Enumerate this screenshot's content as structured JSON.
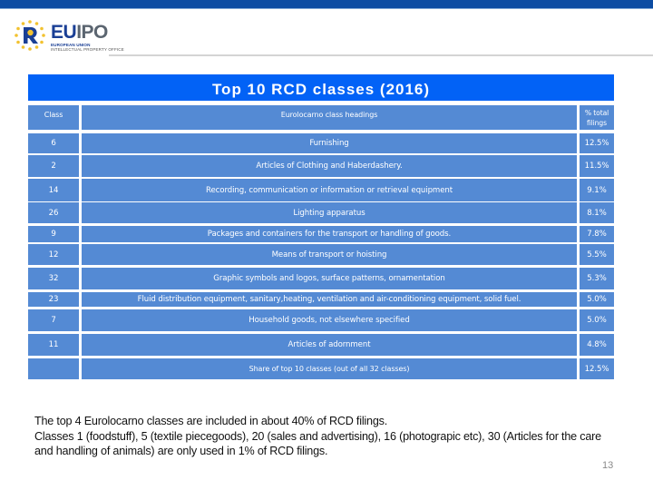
{
  "header": {
    "logo": {
      "word_eu": "EU",
      "word_ipo": "IPO",
      "sub_line1": "European Union",
      "sub_line2": "Intellectual Property Office"
    }
  },
  "colors": {
    "top_bar": "#0c4ca3",
    "title_bar": "#0262f6",
    "cell_fill": "#548ad4"
  },
  "title": "Top 10 RCD classes (2016)",
  "table": {
    "columns": [
      "Class",
      "Eurolocarno class headings",
      "% total filings"
    ],
    "rows": [
      {
        "class": "6",
        "heading": "Furnishing",
        "pct": "12.5%"
      },
      {
        "class": "2",
        "heading": "Articles of Clothing and Haberdashery.",
        "pct": "11.5%"
      },
      {
        "class": "14",
        "heading": "Recording, communication or information or retrieval equipment",
        "pct": "9.1%"
      },
      {
        "class": "26",
        "heading": "Lighting apparatus",
        "pct": "8.1%"
      },
      {
        "class": "9",
        "heading": "Packages and containers for the transport or handling of goods.",
        "pct": "7.8%"
      },
      {
        "class": "12",
        "heading": "Means of transport or hoisting",
        "pct": "5.5%"
      },
      {
        "class": "32",
        "heading": "Graphic symbols and logos, surface patterns, ornamentation",
        "pct": "5.3%"
      },
      {
        "class": "23",
        "heading": "Fluid distribution equipment, sanitary,heating, ventilation and air-conditioning equipment, solid fuel.",
        "pct": "5.0%"
      },
      {
        "class": "7",
        "heading": "Household goods, not elsewhere specified",
        "pct": "5.0%"
      },
      {
        "class": "11",
        "heading": "Articles of adornment",
        "pct": "4.8%"
      }
    ],
    "share_row": {
      "class": "",
      "heading": "Share of top 10 classes (out of all 32 classes)",
      "pct": "12.5%"
    }
  },
  "notes": {
    "line1": "The top 4 Eurolocarno classes are included in about 40% of RCD filings.",
    "line2": "Classes 1 (foodstuff), 5 (textile piecegoods), 20 (sales and advertising), 16 (photograpic etc), 30 (Articles for the care and handling of animals) are only used in 1% of RCD filings."
  },
  "page_number": "13"
}
